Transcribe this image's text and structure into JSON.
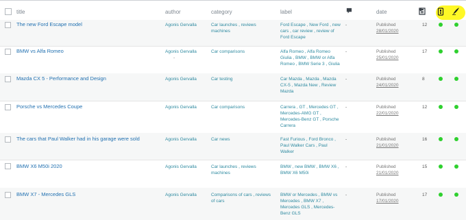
{
  "columns": {
    "title": "title",
    "author": "author",
    "category": "category",
    "label": "label",
    "comments_icon": "comment-icon",
    "date": "date",
    "views_icon": "views-icon",
    "seo_icon": "seo-score-icon",
    "readability_icon": "readability-icon"
  },
  "colors": {
    "link": "#2271b1",
    "status_green": "#2fd02f",
    "highlight": "#fff826"
  },
  "rows": [
    {
      "title": "The new Ford Escape model",
      "author": "Agonis Gervalla",
      "category": [
        "Car launches , reviews",
        "machines"
      ],
      "label": [
        "Ford Escape , New Ford , new",
        "cars , car review , review of",
        "Ford Escape"
      ],
      "comments": "-",
      "status": "Published",
      "date": "28/01/2020",
      "views": "12"
    },
    {
      "title": "BMW vs Alfa Romeo",
      "author": "Agonis Gervalla",
      "author_extra": "-",
      "category": [
        "Car comparisons"
      ],
      "label": [
        "Alfa Romeo , Alfa Romeo",
        "Giulia , BMW , BMW or Alfa",
        "Romeo , BMW Serie 3 , Giulia"
      ],
      "comments": "-",
      "status": "Published",
      "date": "25/01/2020",
      "views": "17"
    },
    {
      "title": "Mazda CX 5 - Performance and Design",
      "author": "Agonis Gervalla",
      "category": [
        "Car testing"
      ],
      "label": [
        "Car Mazda , Mazda , Mazda",
        "CX-5 , Mazda New , Review",
        "Mazda"
      ],
      "comments": "-",
      "status": "Published",
      "date": "24/01/2020",
      "views": "8"
    },
    {
      "title": "Porsche vs Mercedes Coupe",
      "author": "Agonis Gervalla",
      "category": [
        "Car comparisons"
      ],
      "label": [
        "Carrera , GT , Mercedes GT ,",
        "Mercedes-AMG GT ,",
        "Mercedes-Benz GT , Porsche",
        "Carrera"
      ],
      "comments": "-",
      "status": "Published",
      "date": "22/01/2020",
      "views": "12"
    },
    {
      "title": "The cars that Paul Walker had in his garage were sold",
      "author": "Agonis Gervalla",
      "category": [
        "Car news"
      ],
      "label": [
        "Fast Furious , Ford Bronco ,",
        "Paul Walker Cars , Paul Walker"
      ],
      "comments": "-",
      "status": "Published",
      "date": "21/01/2020",
      "views": "16"
    },
    {
      "title": "BMW X6 M50i 2020",
      "author": "Agonis Gervalla",
      "category": [
        "Car launches , reviews",
        "machines"
      ],
      "label": [
        "BMW , new BMW , BMW X6 ,",
        "BMW X6 M50i"
      ],
      "comments": "-",
      "status": "Published",
      "date": "21/01/2020",
      "views": "15"
    },
    {
      "title": "BMW X7 - Mercedes GLS",
      "author": "Agonis Gervalla",
      "category": [
        "Comparisons of cars , reviews",
        "of cars"
      ],
      "label": [
        "BMW or Mercedes , BMW vs",
        "Mercedes , BMW X7 ,",
        "Mercedes GLS , Mercedes-",
        "Benz GLS"
      ],
      "comments": "-",
      "status": "Published",
      "date": "17/01/2020",
      "views": "17"
    }
  ]
}
